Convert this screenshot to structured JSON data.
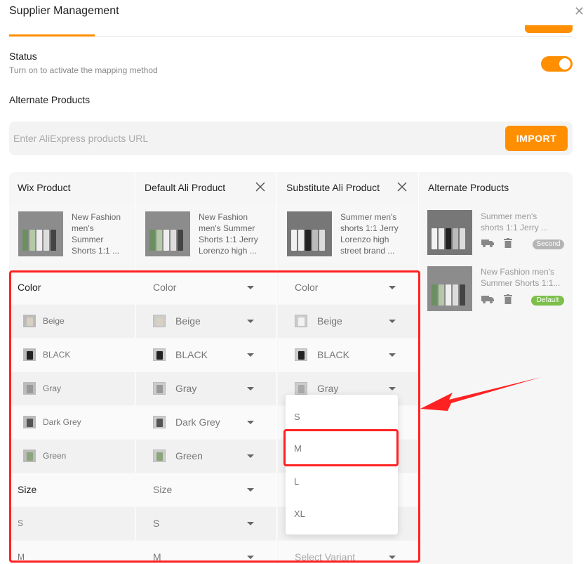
{
  "header": {
    "title": "Supplier Management"
  },
  "status": {
    "label": "Status",
    "sub": "Turn on to activate the mapping method"
  },
  "alternate": {
    "title": "Alternate Products",
    "url_placeholder": "Enter AliExpress products URL",
    "import_label": "IMPORT"
  },
  "table": {
    "columns": [
      "Wix Product",
      "Default Ali Product",
      "Substitute Ali Product",
      "Alternate Products"
    ],
    "products": {
      "wix": "New Fashion men's Summer Shorts 1:1 ...",
      "default": "New Fashion men's Summer Shorts 1:1 Jerry Lorenzo high ...",
      "substitute": "Summer men's shorts 1:1 Jerry Lorenzo high street brand ..."
    },
    "rows": [
      {
        "wix": "Color",
        "def": "Color",
        "sub": "Color"
      },
      {
        "wix": "Beige",
        "def": "Beige",
        "sub": "Beige"
      },
      {
        "wix": "BLACK",
        "def": "BLACK",
        "sub": "BLACK"
      },
      {
        "wix": "Gray",
        "def": "Gray",
        "sub": "Gray"
      },
      {
        "wix": "Dark Grey",
        "def": "Dark Grey",
        "sub": ""
      },
      {
        "wix": "Green",
        "def": "Green",
        "sub": ""
      },
      {
        "wix": "Size",
        "def": "Size",
        "sub": ""
      },
      {
        "wix": "S",
        "def": "S",
        "sub": ""
      },
      {
        "wix": "M",
        "def": "M",
        "sub": "Select Variant"
      }
    ],
    "dropdown_options": [
      "S",
      "M",
      "L",
      "XL"
    ],
    "alternates": [
      {
        "name": "Summer men's shorts 1:1 Jerry ...",
        "badge": "Second",
        "badge_color": "#b5b5b5"
      },
      {
        "name": "New Fashion men's Summer Shorts 1:1...",
        "badge": "Default",
        "badge_color": "#7cc04b"
      }
    ]
  },
  "colors": {
    "accent": "#ff8f00",
    "highlight": "#ff2222"
  }
}
